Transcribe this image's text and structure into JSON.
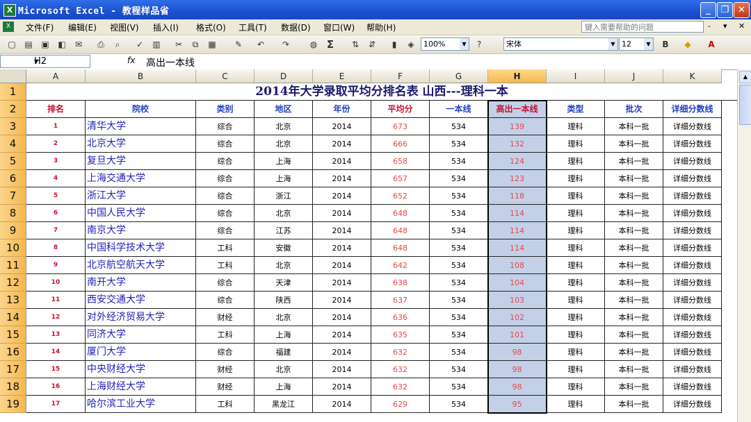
{
  "window": {
    "title": "Microsoft Excel - 教程样品省",
    "app_icon": "X",
    "buttons": [
      "_",
      "❐",
      "✕"
    ]
  },
  "menu": {
    "items": [
      "文件(F)",
      "编辑(E)",
      "视图(V)",
      "插入(I)",
      "格式(O)",
      "工具(T)",
      "数据(D)",
      "窗口(W)",
      "帮助(H)"
    ],
    "help_placeholder": "键入需要帮助的问题",
    "window_controls": [
      "-",
      "▾",
      "✕"
    ]
  },
  "toolbar": {
    "zoom": "100%",
    "font_name": "宋体",
    "font_size": "12",
    "bold": "B",
    "sigma": "Σ"
  },
  "formula_bar": {
    "name_box": "H2",
    "fx": "fx",
    "value": "高出一本线"
  },
  "sheet": {
    "columns": [
      "A",
      "B",
      "C",
      "D",
      "E",
      "F",
      "G",
      "H",
      "I",
      "J",
      "K"
    ],
    "selected_column": "H",
    "row_numbers": [
      "1",
      "2",
      "3",
      "4",
      "5",
      "6",
      "7",
      "8",
      "9",
      "10",
      "11",
      "12",
      "13",
      "14",
      "15",
      "16",
      "17",
      "18",
      "19"
    ],
    "title": "2014年大学录取平均分排名表    山西---理科一本",
    "headers": [
      "排名",
      "院校",
      "类别",
      "地区",
      "年份",
      "平均分",
      "一本线",
      "高出一本线",
      "类型",
      "批次",
      "详细分数线"
    ],
    "rows": [
      [
        "1",
        "清华大学",
        "综合",
        "北京",
        "2014",
        "673",
        "534",
        "139",
        "理科",
        "本科一批",
        "详细分数线"
      ],
      [
        "2",
        "北京大学",
        "综合",
        "北京",
        "2014",
        "666",
        "534",
        "132",
        "理科",
        "本科一批",
        "详细分数线"
      ],
      [
        "3",
        "复旦大学",
        "综合",
        "上海",
        "2014",
        "658",
        "534",
        "124",
        "理科",
        "本科一批",
        "详细分数线"
      ],
      [
        "4",
        "上海交通大学",
        "综合",
        "上海",
        "2014",
        "657",
        "534",
        "123",
        "理科",
        "本科一批",
        "详细分数线"
      ],
      [
        "5",
        "浙江大学",
        "综合",
        "浙江",
        "2014",
        "652",
        "534",
        "118",
        "理科",
        "本科一批",
        "详细分数线"
      ],
      [
        "6",
        "中国人民大学",
        "综合",
        "北京",
        "2014",
        "648",
        "534",
        "114",
        "理科",
        "本科一批",
        "详细分数线"
      ],
      [
        "7",
        "南京大学",
        "综合",
        "江苏",
        "2014",
        "648",
        "534",
        "114",
        "理科",
        "本科一批",
        "详细分数线"
      ],
      [
        "8",
        "中国科学技术大学",
        "工科",
        "安徽",
        "2014",
        "648",
        "534",
        "114",
        "理科",
        "本科一批",
        "详细分数线"
      ],
      [
        "9",
        "北京航空航天大学",
        "工科",
        "北京",
        "2014",
        "642",
        "534",
        "108",
        "理科",
        "本科一批",
        "详细分数线"
      ],
      [
        "10",
        "南开大学",
        "综合",
        "天津",
        "2014",
        "638",
        "534",
        "104",
        "理科",
        "本科一批",
        "详细分数线"
      ],
      [
        "11",
        "西安交通大学",
        "综合",
        "陕西",
        "2014",
        "637",
        "534",
        "103",
        "理科",
        "本科一批",
        "详细分数线"
      ],
      [
        "12",
        "对外经济贸易大学",
        "财经",
        "北京",
        "2014",
        "636",
        "534",
        "102",
        "理科",
        "本科一批",
        "详细分数线"
      ],
      [
        "13",
        "同济大学",
        "工科",
        "上海",
        "2014",
        "635",
        "534",
        "101",
        "理科",
        "本科一批",
        "详细分数线"
      ],
      [
        "14",
        "厦门大学",
        "综合",
        "福建",
        "2014",
        "632",
        "534",
        "98",
        "理科",
        "本科一批",
        "详细分数线"
      ],
      [
        "15",
        "中央财经大学",
        "财经",
        "北京",
        "2014",
        "632",
        "534",
        "98",
        "理科",
        "本科一批",
        "详细分数线"
      ],
      [
        "16",
        "上海财经大学",
        "财经",
        "上海",
        "2014",
        "632",
        "534",
        "98",
        "理科",
        "本科一批",
        "详细分数线"
      ],
      [
        "17",
        "哈尔滨工业大学",
        "工科",
        "黑龙江",
        "2014",
        "629",
        "534",
        "95",
        "理科",
        "本科一批",
        "详细分数线"
      ]
    ]
  },
  "colors": {
    "title_bar": "#1c4fd0",
    "header_blue": "#1f3fbf",
    "rank_red": "#c8102e",
    "selected_col_fill": "#c4d0e8",
    "row_header_orange": "#f5b74e"
  }
}
